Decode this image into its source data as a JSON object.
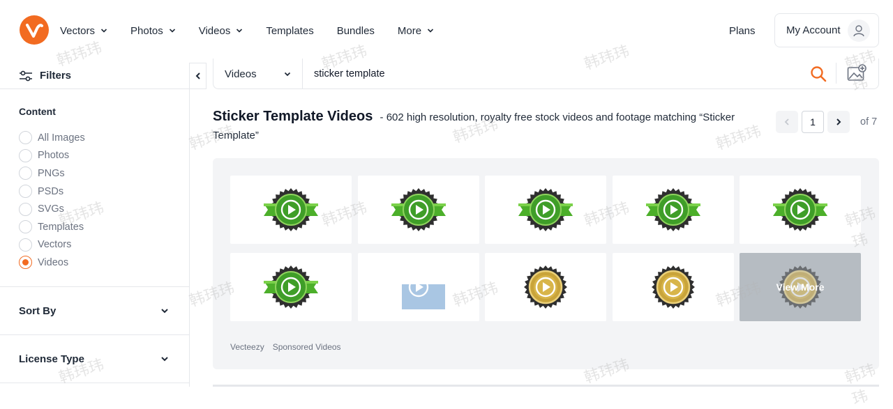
{
  "header": {
    "nav": [
      {
        "label": "Vectors",
        "has_dropdown": true
      },
      {
        "label": "Photos",
        "has_dropdown": true
      },
      {
        "label": "Videos",
        "has_dropdown": true
      },
      {
        "label": "Templates",
        "has_dropdown": false
      },
      {
        "label": "Bundles",
        "has_dropdown": false
      },
      {
        "label": "More",
        "has_dropdown": true
      }
    ],
    "plans_label": "Plans",
    "account_label": "My Account",
    "brand_color": "#f26b21"
  },
  "sidebar": {
    "filters_label": "Filters",
    "content_title": "Content",
    "content_options": [
      {
        "label": "All Images",
        "selected": false
      },
      {
        "label": "Photos",
        "selected": false
      },
      {
        "label": "PNGs",
        "selected": false
      },
      {
        "label": "PSDs",
        "selected": false
      },
      {
        "label": "SVGs",
        "selected": false
      },
      {
        "label": "Templates",
        "selected": false
      },
      {
        "label": "Vectors",
        "selected": false
      },
      {
        "label": "Videos",
        "selected": true
      }
    ],
    "sort_by_label": "Sort By",
    "license_type_label": "License Type"
  },
  "search": {
    "type_value": "Videos",
    "query": "sticker template"
  },
  "results": {
    "title": "Sticker Template Videos",
    "subtitle": "- 602 high resolution, royalty free stock videos and footage matching “Sticker Template”"
  },
  "pagination": {
    "current_page": "1",
    "of_label": "of 7"
  },
  "sponsored": {
    "tiles": [
      {
        "kind": "green"
      },
      {
        "kind": "green"
      },
      {
        "kind": "green"
      },
      {
        "kind": "green"
      },
      {
        "kind": "green"
      },
      {
        "kind": "green"
      },
      {
        "kind": "blue"
      },
      {
        "kind": "gold"
      },
      {
        "kind": "gold"
      },
      {
        "kind": "viewmore"
      }
    ],
    "view_more_label": "View More",
    "source_label": "Vecteezy",
    "sponsored_label": "Sponsored Videos"
  },
  "watermark_text": "韩玮玮"
}
